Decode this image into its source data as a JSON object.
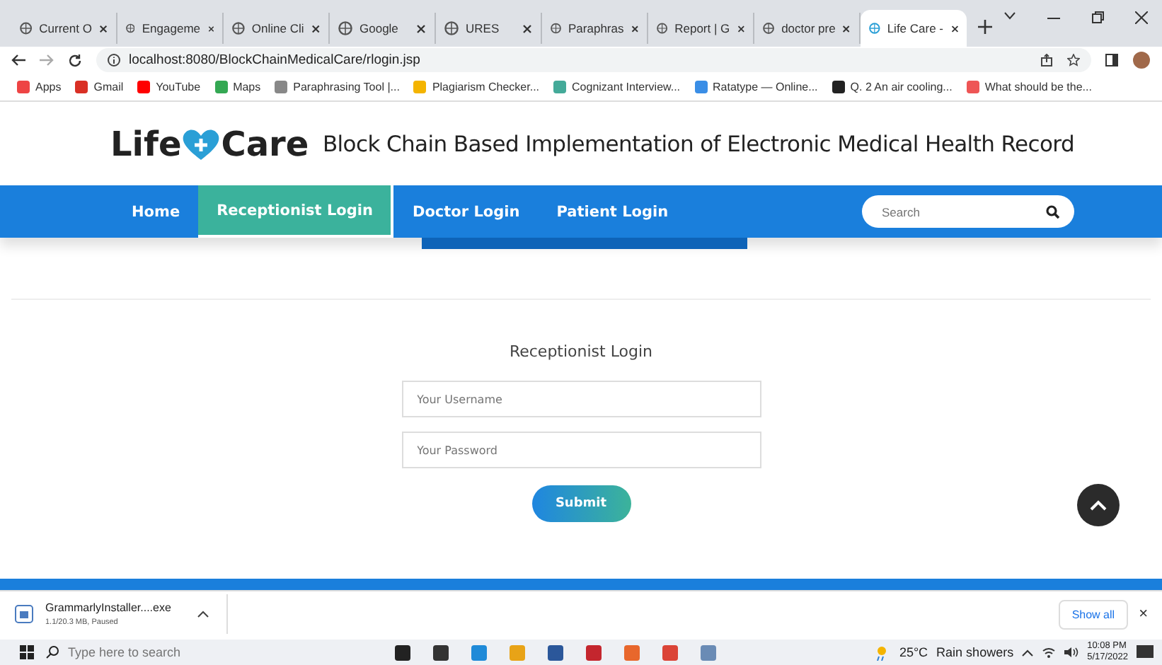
{
  "browser": {
    "tabs": [
      {
        "title": "Current O",
        "selected": false
      },
      {
        "title": "Engageme",
        "selected": false
      },
      {
        "title": "Online Cli",
        "selected": false
      },
      {
        "title": "Google",
        "selected": false
      },
      {
        "title": "URES",
        "selected": false
      },
      {
        "title": "Paraphras",
        "selected": false
      },
      {
        "title": "Report | G",
        "selected": false
      },
      {
        "title": "doctor pre",
        "selected": false
      },
      {
        "title": "Life Care -",
        "selected": true
      }
    ],
    "address": "localhost:8080/BlockChainMedicalCare/rlogin.jsp",
    "bookmarks": [
      "Apps",
      "Gmail",
      "YouTube",
      "Maps",
      "Paraphrasing Tool |...",
      "Plagiarism Checker...",
      "Cognizant Interview...",
      "Ratatype — Online...",
      "Q. 2 An air cooling...",
      "What should be the..."
    ]
  },
  "header": {
    "logo_left": "Life",
    "logo_right": "Care",
    "title": "Block Chain Based Implementation of Electronic Medical Health Record"
  },
  "nav": {
    "items": [
      {
        "label": "Home",
        "selected": false
      },
      {
        "label": "Receptionist Login",
        "selected": true
      },
      {
        "label": "Doctor Login",
        "selected": false
      },
      {
        "label": "Patient Login",
        "selected": false
      }
    ],
    "search": {
      "placeholder": "Search"
    }
  },
  "form": {
    "title": "Receptionist Login",
    "fields": [
      {
        "placeholder": "Your Username"
      },
      {
        "placeholder": "Your Password"
      }
    ],
    "submit": "Submit"
  },
  "download": {
    "file": "GrammarlyInstaller....exe",
    "status": "1.1/20.3 MB, Paused",
    "show_all": "Show all",
    "close": "×"
  },
  "taskbar": {
    "search": {
      "placeholder": "Type here to search"
    },
    "temperature": "25°C",
    "weather": "Rain showers",
    "time": "10:08 PM",
    "date": "5/17/2022"
  }
}
